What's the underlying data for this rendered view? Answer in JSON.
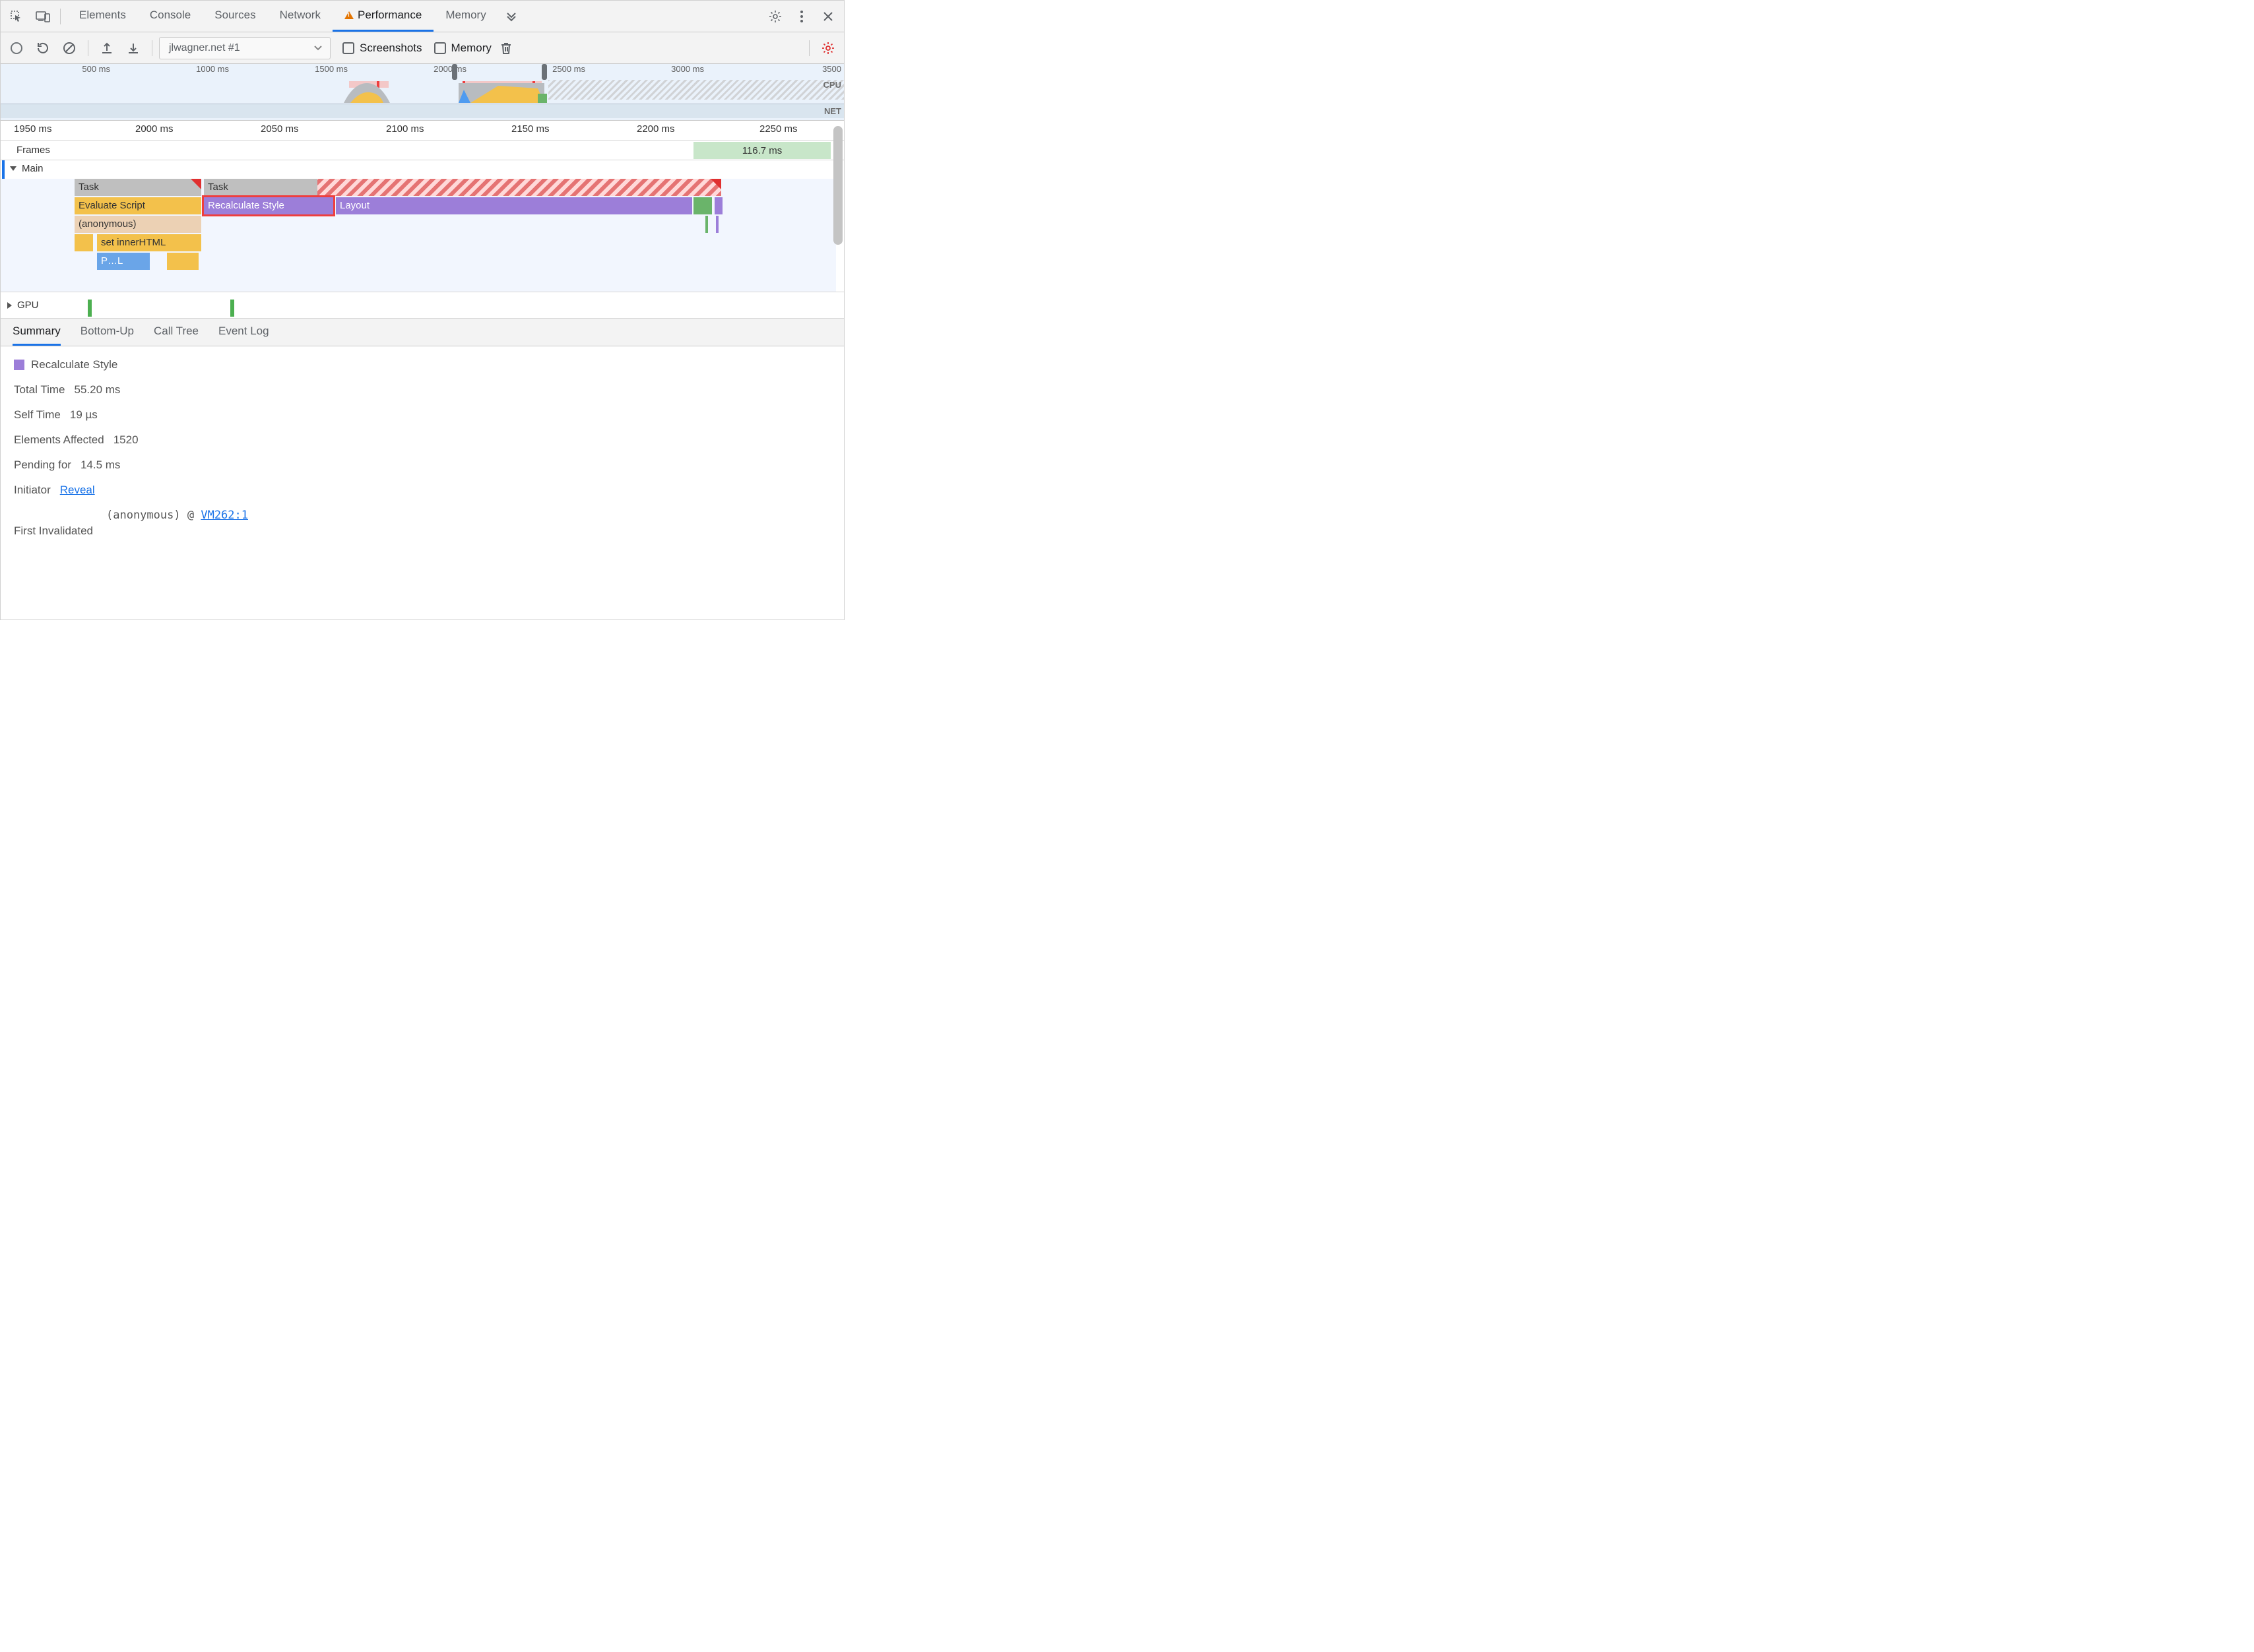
{
  "topTabs": {
    "elements": "Elements",
    "console": "Console",
    "sources": "Sources",
    "network": "Network",
    "performance": "Performance",
    "memory": "Memory"
  },
  "toolbar": {
    "site": "jlwagner.net #1",
    "screenshots": "Screenshots",
    "memory": "Memory"
  },
  "overview": {
    "ticks": [
      "500 ms",
      "1000 ms",
      "1500 ms",
      "2000 ms",
      "2500 ms",
      "3000 ms",
      "3500"
    ],
    "cpu_label": "CPU",
    "net_label": "NET"
  },
  "mainRuler": [
    "1950 ms",
    "2000 ms",
    "2050 ms",
    "2100 ms",
    "2150 ms",
    "2200 ms",
    "2250 ms"
  ],
  "rows": {
    "frames": "Frames",
    "frames_value": "116.7 ms",
    "main": "Main",
    "gpu": "GPU"
  },
  "flame": {
    "task1": "Task",
    "task2": "Task",
    "evaluate": "Evaluate Script",
    "recalc": "Recalculate Style",
    "layout": "Layout",
    "anon": "(anonymous)",
    "innerHTML": "set innerHTML",
    "pl": "P…L"
  },
  "detailTabs": {
    "summary": "Summary",
    "bottomup": "Bottom-Up",
    "calltree": "Call Tree",
    "eventlog": "Event Log"
  },
  "summary": {
    "title": "Recalculate Style",
    "totalTime_k": "Total Time",
    "totalTime_v": "55.20 ms",
    "selfTime_k": "Self Time",
    "selfTime_v": "19 µs",
    "elements_k": "Elements Affected",
    "elements_v": "1520",
    "pending_k": "Pending for",
    "pending_v": "14.5 ms",
    "initiator_k": "Initiator",
    "initiator_v": "Reveal",
    "firstInval_k": "First Invalidated",
    "callsite_fn": "(anonymous)",
    "callsite_at": "@",
    "callsite_loc": "VM262:1"
  }
}
